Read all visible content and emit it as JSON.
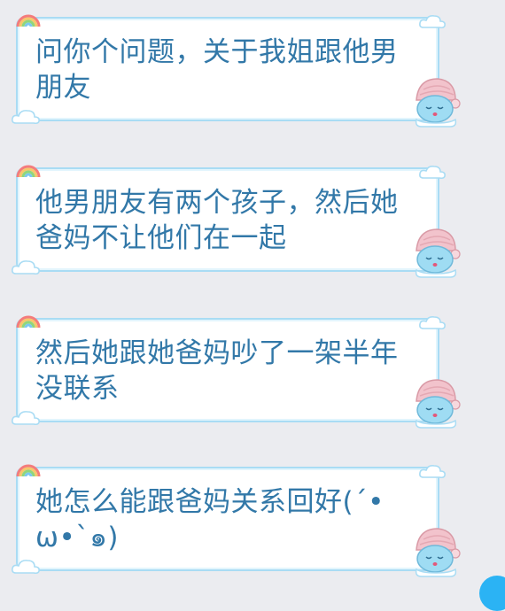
{
  "messages": [
    {
      "text": "问你个问题，关于我姐跟他男朋友"
    },
    {
      "text": "他男朋友有两个孩子，然后她爸妈不让他们在一起"
    },
    {
      "text": "然后她跟她爸妈吵了一架半年没联系"
    },
    {
      "text": "她怎么能跟爸妈关系回好(´•ω•`๑)"
    }
  ],
  "colors": {
    "background": "#ebecf0",
    "bubble_fill": "#ffffff",
    "bubble_border": "#a9dcf4",
    "text": "#3278a8",
    "mascot_hat": "#f2c3cc",
    "mascot_face": "#9fdcf3",
    "accent_dot": "#2bb3f4"
  },
  "icons": [
    "rainbow-icon",
    "cloud-icon",
    "sleeping-mascot-icon"
  ]
}
